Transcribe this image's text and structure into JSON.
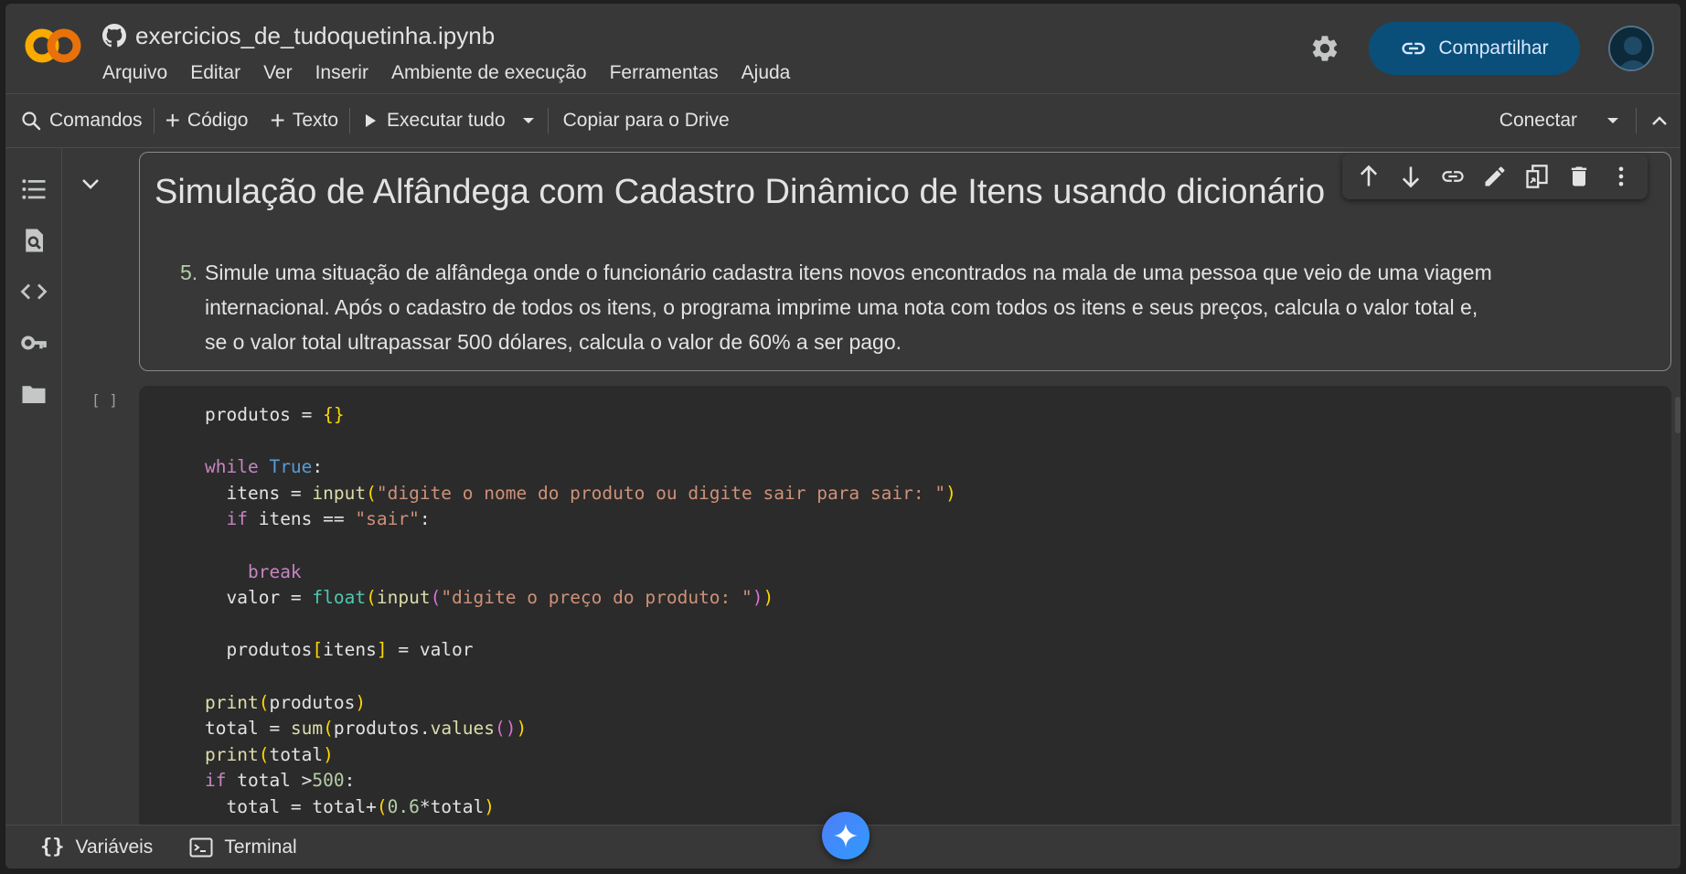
{
  "notebook": {
    "title": "exercicios_de_tudoquetinha.ipynb"
  },
  "menu": [
    "Arquivo",
    "Editar",
    "Ver",
    "Inserir",
    "Ambiente de execução",
    "Ferramentas",
    "Ajuda"
  ],
  "header": {
    "share_label": "Compartilhar"
  },
  "toolbar": {
    "commands": "Comandos",
    "code": "Código",
    "text": "Texto",
    "run_all": "Executar tudo",
    "copy_drive": "Copiar para o Drive",
    "connect": "Conectar"
  },
  "text_cell": {
    "heading": "Simulação de Alfândega com Cadastro Dinâmico de Itens usando dicionário",
    "item_number": "5.",
    "item_text": "Simule uma situação de alfândega onde o funcionário cadastra itens novos encontrados na mala de uma pessoa que veio de uma viagem internacional. Após o cadastro de todos os itens, o programa imprime uma nota com todos os itens e seus preços, calcula o valor total e, se o valor total ultrapassar 500 dólares, calcula o valor de 60% a ser pago."
  },
  "code_cell": {
    "run_indicator": "[ ]"
  },
  "bottombar": {
    "variables": "Variáveis",
    "terminal": "Terminal"
  },
  "colors": {
    "share_bg": "#0a4f7a",
    "logo_orange": "#f9ab00",
    "logo_dark_orange": "#e8710a",
    "gemini": "#4f7df7"
  }
}
